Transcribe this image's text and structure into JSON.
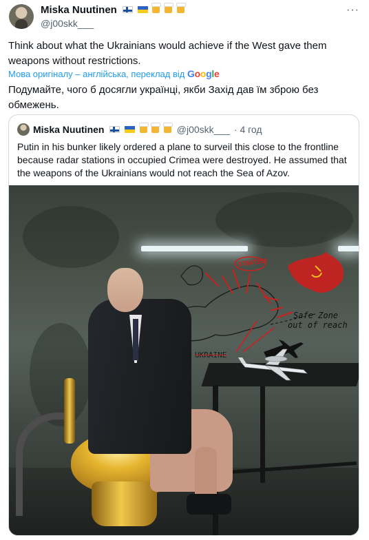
{
  "author": {
    "name": "Miska Nuutinen",
    "handle": "@j00skk___"
  },
  "menu": {
    "more_label": "···"
  },
  "tweet": {
    "text": "Think about what the Ukrainians would achieve if the West gave them weapons without restrictions.",
    "translate_prefix": "Мова оригіналу – англійська, переклад від",
    "translate_brand": [
      "G",
      "o",
      "o",
      "g",
      "l",
      "e"
    ],
    "translated_text": "Подумайте, чого б досягли українці, якби Захід дав їм зброю без обмежень."
  },
  "quoted": {
    "name": "Miska Nuutinen",
    "handle": "@j00skk___",
    "time": "· 4 год",
    "text": "Putin in his bunker likely ordered a plane to surveil this close to the frontline because radar stations in occupied Crimea were destroyed. He assumed that the weapons of the Ukrainians would not reach the Sea of Azov."
  },
  "media": {
    "graffiti_strategy": "STRATEGY",
    "graffiti_ukraine": "UKRAINE",
    "graffiti_safe_zone": "Safe Zone",
    "graffiti_out_of_reach": "out of reach"
  },
  "icons": {
    "flags": [
      "finland-flag-icon",
      "ukraine-flag-icon"
    ],
    "beers": [
      "beer-mug-icon",
      "beer-mug-icon",
      "beer-mug-icon"
    ]
  }
}
